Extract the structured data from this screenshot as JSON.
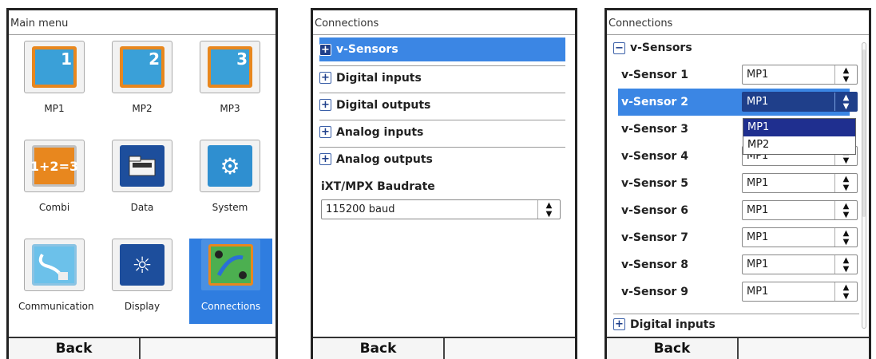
{
  "screen1": {
    "title": "Main menu",
    "tiles": [
      {
        "label": "MP1",
        "num": "1"
      },
      {
        "label": "MP2",
        "num": "2"
      },
      {
        "label": "MP3",
        "num": "3"
      },
      {
        "label": "Combi"
      },
      {
        "label": "Data"
      },
      {
        "label": "System"
      },
      {
        "label": "Communication"
      },
      {
        "label": "Display"
      },
      {
        "label": "Connections"
      }
    ],
    "back": "Back"
  },
  "screen2": {
    "title": "Connections",
    "items": [
      "v-Sensors",
      "Digital inputs",
      "Digital outputs",
      "Analog inputs",
      "Analog outputs"
    ],
    "baud_label": "iXT/MPX Baudrate",
    "baud_value": "115200 baud",
    "back": "Back"
  },
  "screen3": {
    "title": "Connections",
    "group": "v-Sensors",
    "sensors": [
      {
        "label": "v-Sensor 1",
        "value": "MP1"
      },
      {
        "label": "v-Sensor 2",
        "value": "MP1"
      },
      {
        "label": "v-Sensor 3",
        "value": "MP1"
      },
      {
        "label": "v-Sensor 4",
        "value": "MP1"
      },
      {
        "label": "v-Sensor 5",
        "value": "MP1"
      },
      {
        "label": "v-Sensor 6",
        "value": "MP1"
      },
      {
        "label": "v-Sensor 7",
        "value": "MP1"
      },
      {
        "label": "v-Sensor 8",
        "value": "MP1"
      },
      {
        "label": "v-Sensor 9",
        "value": "MP1"
      }
    ],
    "dropdown_options": [
      "MP1",
      "MP2"
    ],
    "next_group": "Digital inputs",
    "back": "Back"
  },
  "colors": {
    "selection": "#3b86e4",
    "dark_selection": "#1f3f8a",
    "accent_orange": "#e8871e"
  }
}
